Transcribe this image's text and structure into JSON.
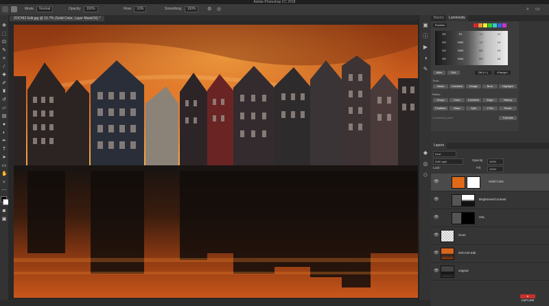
{
  "window": {
    "title": "Adobe Photoshop CC 2018"
  },
  "options": {
    "mode_label": "Mode:",
    "mode_value": "Normal",
    "opacity_label": "Opacity:",
    "opacity_value": "100%",
    "flow_label": "Flow:",
    "flow_value": "10%",
    "smoothing_label": "Smoothing:",
    "smoothing_value": "100%"
  },
  "document": {
    "tab": "ZOCHI3 Edit.jpg @ 16.7% (Solid Color, Layer Mask/16) *"
  },
  "panels": {
    "top_tabs": [
      "Basics",
      "Luminosity"
    ],
    "layers_tab": "Layers"
  },
  "luminosity": {
    "preview_label": "Preview",
    "masks": [
      [
        "D2",
        "D1",
        "L1",
        "L2"
      ],
      [
        "D3",
        "DM2",
        "L3",
        "L4"
      ],
      [
        "D4",
        "DM3",
        "M1",
        "L5"
      ],
      [
        "D5",
        "DM4",
        "M2",
        "L6"
      ]
    ],
    "after_btn": "After",
    "exit_btn": "Exit",
    "diff_value": "Diff (+/-)",
    "range_label": "<Range>",
    "tools_label": "Tools",
    "row1": [
      "Mask",
      "Combine",
      "Dodge",
      "Burn",
      "Highlight"
    ],
    "section_label": "Refine",
    "row2": [
      "Group",
      "Color",
      "Combine",
      "Edge",
      "History"
    ],
    "row3": [
      "Postfilter",
      "Warp",
      "Split",
      "✔Sel",
      "Reset"
    ],
    "footer_note": "Luminosity panel",
    "tutorials_btn": "Tutorials"
  },
  "layers": {
    "filter_label": "Kind",
    "blend_mode": "Soft Light",
    "opacity_label": "Opacity:",
    "opacity_value": "100%",
    "lock_label": "Lock:",
    "fill_label": "Fill:",
    "fill_value": "100%",
    "items": [
      {
        "name": "Solid Color",
        "selected": true
      },
      {
        "name": "Brightness/Contrast",
        "selected": false
      },
      {
        "name": "HSL",
        "selected": false
      },
      {
        "name": "clone",
        "selected": false
      },
      {
        "name": "ZOCHI3 Edit",
        "selected": false
      },
      {
        "name": "original",
        "selected": false
      }
    ]
  },
  "status": {
    "badge": "● CAPTURE"
  },
  "colors": {
    "accent": "#e06a1a",
    "sky_top": "#c1531b",
    "sky_mid": "#f08a2a"
  }
}
